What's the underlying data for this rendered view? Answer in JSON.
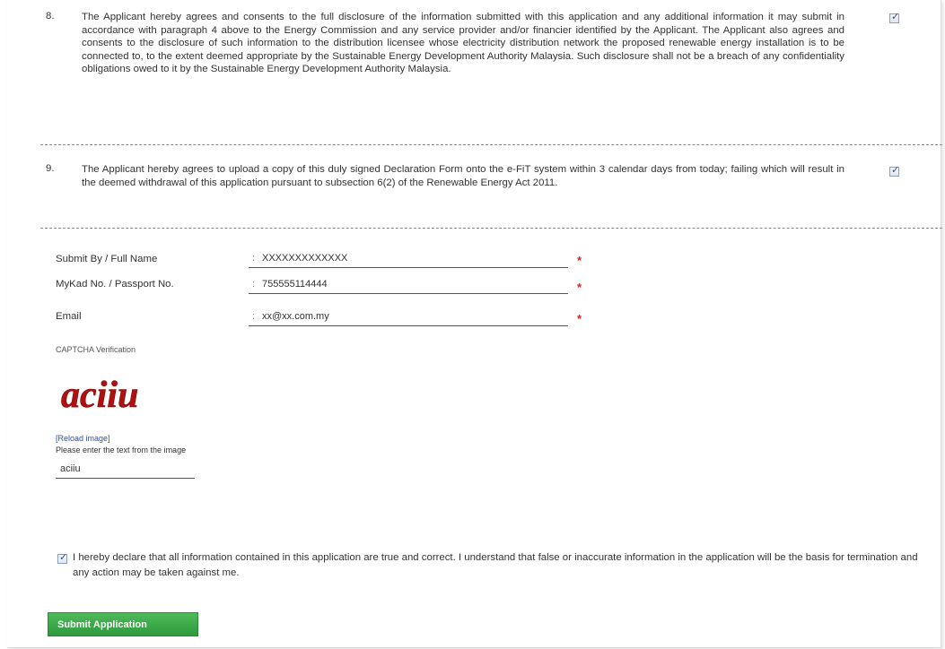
{
  "clauses": [
    {
      "number": "8.",
      "text": "The Applicant hereby agrees and consents to the full disclosure of the information submitted with this application and any additional information it may submit in accordance with paragraph 4 above to the Energy Commission and any service provider and/or financier identified by the Applicant. The Applicant also agrees and consents to the disclosure of such information to the distribution licensee whose electricity distribution network the proposed renewable energy installation is to be connected to, to the extent deemed appropriate by the Sustainable Energy Development Authority Malaysia. Such disclosure shall not be a breach of any confidentiality obligations owed to it by the Sustainable Energy Development Authority Malaysia.",
      "checked": true
    },
    {
      "number": "9.",
      "text": "The Applicant hereby agrees to upload a copy of this duly signed Declaration Form onto the e-FiT system within 3 calendar days from today; failing which will result in the deemed withdrawal of this application pursuant to subsection 6(2) of the Renewable Energy Act 2011.",
      "checked": true
    }
  ],
  "form": {
    "full_name_label": "Submit By / Full Name",
    "full_name_value": "XXXXXXXXXXXXX",
    "mykad_label": "MyKad No. / Passport No.",
    "mykad_value": "755555114444",
    "email_label": "Email",
    "email_value": "xx@xx.com.my",
    "colon": ":",
    "required_marker": "*"
  },
  "captcha": {
    "label": "CAPTCHA Verification",
    "image_text": "aciiu",
    "reload_link": "[Reload image]",
    "prompt": "Please enter the text from the image",
    "input_value": "aciiu"
  },
  "declaration": {
    "checked": true,
    "text": "I hereby declare that all information contained in this application are true and correct. I understand that false or inaccurate information in the application will be the basis for termination and any action may be taken against me."
  },
  "submit_button_label": "Submit Application",
  "colors": {
    "required": "#e02020",
    "button": "#3aa646",
    "link": "#2a50b0",
    "captcha": "#b01010"
  },
  "icons": {
    "checkbox_checked": "checkbox-checked-icon",
    "required": "asterisk-icon"
  }
}
